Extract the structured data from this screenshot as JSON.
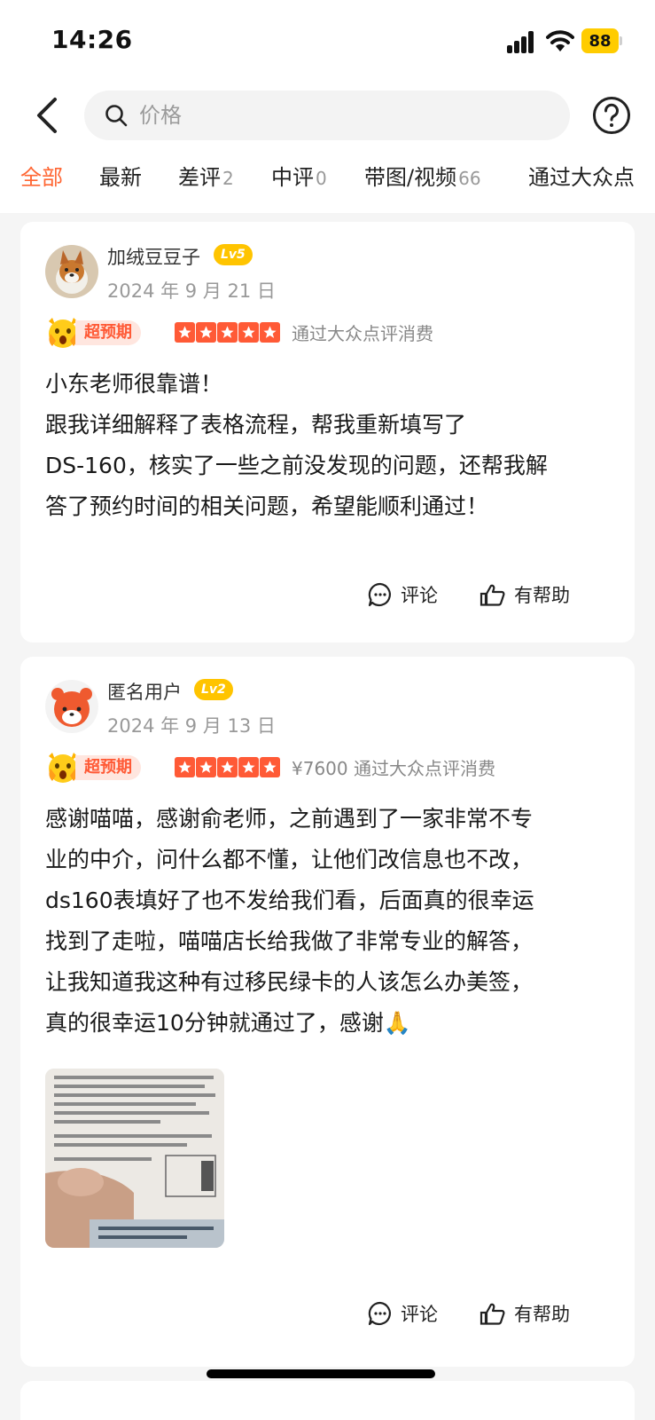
{
  "status_bar": {
    "time": "14:26",
    "battery": "88"
  },
  "search": {
    "placeholder": "价格"
  },
  "tabs": [
    {
      "label": "全部",
      "count": ""
    },
    {
      "label": "最新",
      "count": ""
    },
    {
      "label": "差评",
      "count": "2"
    },
    {
      "label": "中评",
      "count": "0"
    },
    {
      "label": "带图/视频",
      "count": "66"
    },
    {
      "label": "通过大众点",
      "count": ""
    }
  ],
  "reviews": [
    {
      "username": "加绒豆豆子",
      "level": "Lv5",
      "date": "2024 年 9 月 21 日",
      "tag": "超预期",
      "stars": 5,
      "meta": "通过大众点评消费",
      "lines": [
        "小东老师很靠谱！",
        "跟我详细解释了表格流程，帮我重新填写了",
        "DS-160，核实了一些之前没发现的问题，还帮我解",
        "答了预约时间的相关问题，希望能顺利通过！"
      ],
      "comment_label": "评论",
      "helpful_label": "有帮助"
    },
    {
      "username": "匿名用户",
      "level": "Lv2",
      "date": "2024 年 9 月 13 日",
      "tag": "超预期",
      "stars": 5,
      "meta": "¥7600 通过大众点评消费",
      "lines": [
        "感谢喵喵，感谢俞老师，之前遇到了一家非常不专",
        "业的中介，问什么都不懂，让他们改信息也不改，",
        "ds160表填好了也不发给我们看，后面真的很幸运",
        "找到了走啦，喵喵店长给我做了非常专业的解答，",
        "让我知道我这种有过移民绿卡的人该怎么办美签，",
        "真的很幸运10分钟就通过了，感谢🙏"
      ],
      "comment_label": "评论",
      "helpful_label": "有帮助"
    }
  ],
  "colors": {
    "accent": "#ff6633",
    "star": "#ff5a36",
    "level_badge": "#ffc400"
  }
}
